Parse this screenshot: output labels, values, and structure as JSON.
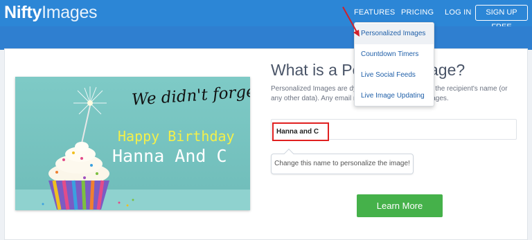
{
  "header": {
    "logo_bold": "Nifty",
    "logo_light": "Images",
    "nav": {
      "features": "FEATURES",
      "pricing": "PRICING",
      "login": "LOG IN",
      "signup": "SIGN UP FREE"
    }
  },
  "features_menu": {
    "items": [
      {
        "label": "Personalized Images"
      },
      {
        "label": "Countdown Timers"
      },
      {
        "label": "Live Social Feeds"
      },
      {
        "label": "Live Image Updating"
      }
    ]
  },
  "preview_image": {
    "line1": "We didn't forget!",
    "line2": "Happy Birthday",
    "line3": "Hanna And C"
  },
  "main": {
    "heading_left": "What is a Pers",
    "heading_right": "age?",
    "desc_line1_left": "Personalized Images are dyn",
    "desc_line1_right": "ased on the recipient's name (or",
    "desc_line2_left": "any other data). Any email m",
    "desc_line2_right": "ur images.",
    "name_input_value": "Hanna and C",
    "tooltip": "Change this name to personalize the image!",
    "learn_more": "Learn More"
  },
  "colors": {
    "header_blue": "#2c86d6",
    "button_green": "#45b14a",
    "highlight_red": "#e02020",
    "link_blue": "#1f5fa8"
  }
}
